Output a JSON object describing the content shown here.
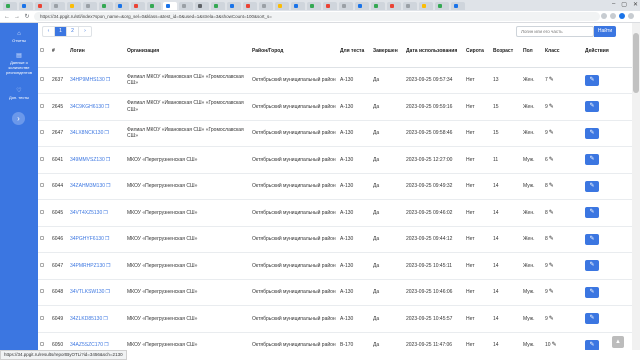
{
  "browser": {
    "url": "https://34.ppgit.ru/stl/index?spon_name=&org_sel=0&klass=&test_id=0&used=1&strela=3&showCount=100&sort_s=",
    "status_url": "https://34.ppgit.ru/results/reportByOTLi?id=3456&sch=2130",
    "tab_colors": [
      "#34a853",
      "#1a73e8",
      "#ea4335",
      "#9aa0a6",
      "#fbbc04",
      "#9aa0a6",
      "#34a853",
      "#1a73e8",
      "#ea4335",
      "#34a853",
      "#1a73e8",
      "#9aa0a6",
      "#5f6368",
      "#34a853",
      "#1a73e8",
      "#ea4335",
      "#9aa0a6",
      "#fbbc04",
      "#1a73e8",
      "#34a853",
      "#ea4335",
      "#9aa0a6",
      "#1a73e8",
      "#34a853",
      "#ea4335",
      "#9aa0a6",
      "#fbbc04",
      "#34a853",
      "#1a73e8"
    ],
    "active_tab_index": 10
  },
  "sidebar": {
    "items": [
      {
        "icon": "home-icon",
        "label": "Отчеты"
      },
      {
        "icon": "chart-icon",
        "label": "Данные о количестве респондентов"
      },
      {
        "icon": "heart-icon",
        "label": "Доп. тесты"
      }
    ],
    "toggle_icon": "chevron-right-icon"
  },
  "toolbar": {
    "pager": {
      "prev": "‹",
      "pages": [
        "1",
        "2"
      ],
      "active_page": "1",
      "next": "›"
    },
    "search_placeholder": "Логин или его часть",
    "search_button": "Найти"
  },
  "table": {
    "headers": [
      "",
      "#",
      "Логин",
      "Организация",
      "Район/Город",
      "Для теста",
      "Завершен",
      "Дата использования",
      "Сирота",
      "Возраст",
      "Пол",
      "Класс",
      "Действия"
    ],
    "rows": [
      {
        "id": "2637",
        "login": "34HP9MHS130",
        "org": "Филиал МКОУ «Ивановская СШ» «Громославская СШ»",
        "district": "Октябрьский муниципальный район",
        "test": "А-130",
        "done": "Да",
        "date": "2023-09-25 09:57:34",
        "orphan": "Нет",
        "age": "13",
        "gender": "Жен.",
        "klass": "7"
      },
      {
        "id": "2645",
        "login": "34C9KGH6130",
        "org": "Филиал МКОУ «Ивановская СШ» «Громославская СШ»",
        "district": "Октябрьский муниципальный район",
        "test": "А-130",
        "done": "Да",
        "date": "2023-09-25 09:59:16",
        "orphan": "Нет",
        "age": "15",
        "gender": "Жен.",
        "klass": "9"
      },
      {
        "id": "2647",
        "login": "34LX8NCK130",
        "org": "Филиал МКОУ «Ивановская СШ» «Громославская СШ»",
        "district": "Октябрьский муниципальный район",
        "test": "А-130",
        "done": "Да",
        "date": "2023-09-25 09:58:46",
        "orphan": "Нет",
        "age": "15",
        "gender": "Жен.",
        "klass": "9"
      },
      {
        "id": "6041",
        "login": "349MMVSZ130",
        "org": "МКОУ «Перегрузненская СШ»",
        "district": "Октябрьский муниципальный район",
        "test": "А-130",
        "done": "Да",
        "date": "2023-09-25 12:27:00",
        "orphan": "Нет",
        "age": "11",
        "gender": "Муж.",
        "klass": "6"
      },
      {
        "id": "6044",
        "login": "34ZAHM3M130",
        "org": "МКОУ «Перегрузненская СШ»",
        "district": "Октябрьский муниципальный район",
        "test": "А-130",
        "done": "Да",
        "date": "2023-09-25 09:49:32",
        "orphan": "Нет",
        "age": "14",
        "gender": "Муж.",
        "klass": "8"
      },
      {
        "id": "6045",
        "login": "34VT4XZ5130",
        "org": "МКОУ «Перегрузненская СШ»",
        "district": "Октябрьский муниципальный район",
        "test": "А-130",
        "done": "Да",
        "date": "2023-09-25 09:46:02",
        "orphan": "Нет",
        "age": "14",
        "gender": "Жен.",
        "klass": "8"
      },
      {
        "id": "6046",
        "login": "34PGHYF6130",
        "org": "МКОУ «Перегрузненская СШ»",
        "district": "Октябрьский муниципальный район",
        "test": "А-130",
        "done": "Да",
        "date": "2023-09-25 09:44:12",
        "orphan": "Нет",
        "age": "14",
        "gender": "Жен.",
        "klass": "8"
      },
      {
        "id": "6047",
        "login": "34PMRHPZ130",
        "org": "МКОУ «Перегрузненская СШ»",
        "district": "Октябрьский муниципальный район",
        "test": "А-130",
        "done": "Да",
        "date": "2023-09-25 10:45:11",
        "orphan": "Нет",
        "age": "14",
        "gender": "Жен.",
        "klass": "9"
      },
      {
        "id": "6048",
        "login": "34VTLKSW130",
        "org": "МКОУ «Перегрузненская СШ»",
        "district": "Октябрьский муниципальный район",
        "test": "А-130",
        "done": "Да",
        "date": "2023-09-25 10:46:06",
        "orphan": "Нет",
        "age": "14",
        "gender": "Муж.",
        "klass": "9"
      },
      {
        "id": "6049",
        "login": "34ZLKD85130",
        "org": "МКОУ «Перегрузненская СШ»",
        "district": "Октябрьский муниципальный район",
        "test": "А-130",
        "done": "Да",
        "date": "2023-09-25 10:45:57",
        "orphan": "Нет",
        "age": "14",
        "gender": "Муж.",
        "klass": "9"
      },
      {
        "id": "6050",
        "login": "34AZ5SZC170",
        "org": "МКОУ «Перегрузненская СШ»",
        "district": "Октябрьский муниципальный район",
        "test": "В-170",
        "done": "Да",
        "date": "2023-09-25 11:47:06",
        "orphan": "Нет",
        "age": "14",
        "gender": "Муж.",
        "klass": "10"
      }
    ]
  },
  "colors": {
    "accent": "#3b76e1"
  }
}
